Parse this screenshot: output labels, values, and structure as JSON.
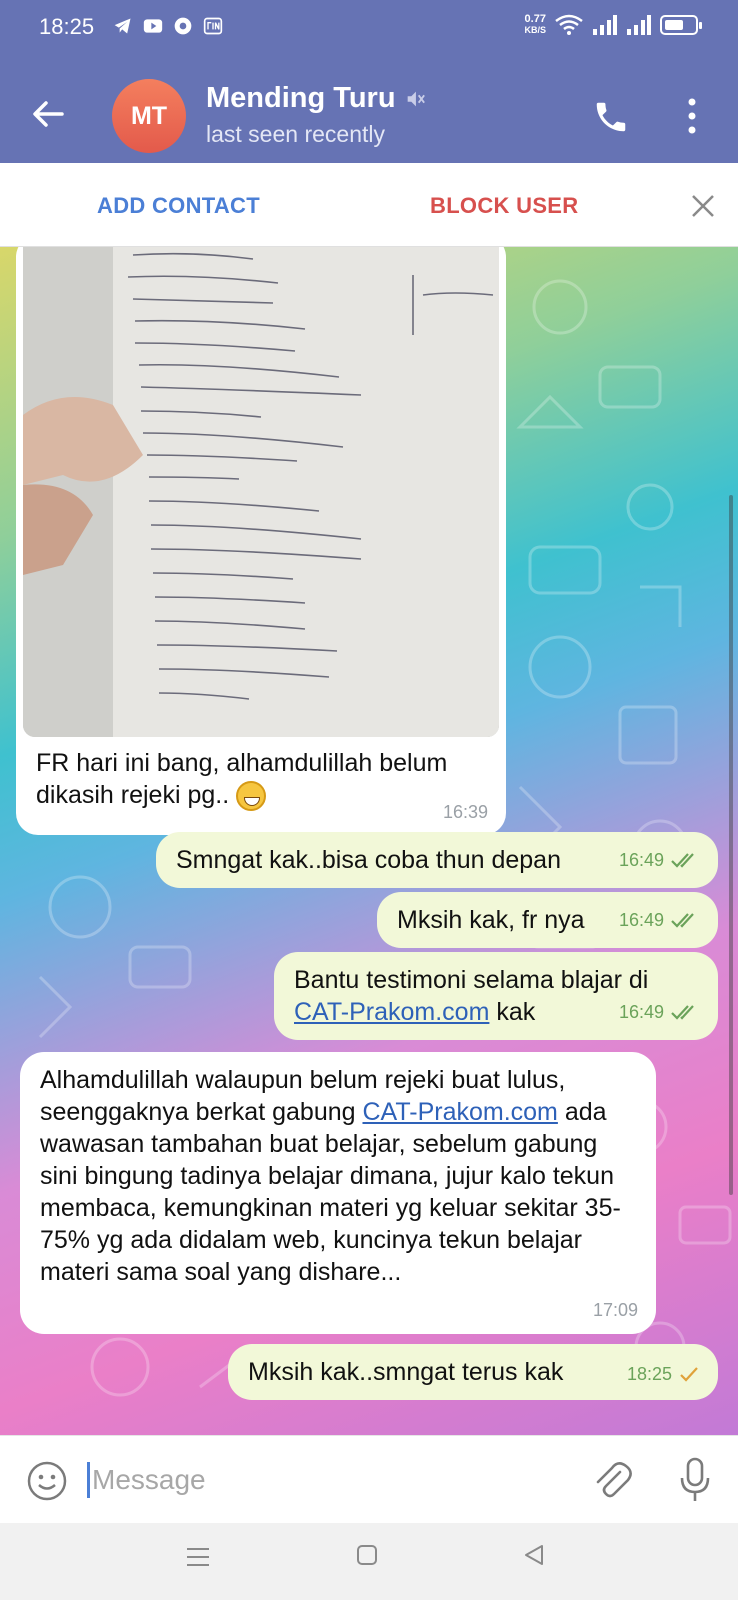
{
  "status_bar": {
    "time": "18:25",
    "left_icons": [
      "telegram-icon",
      "youtube-icon",
      "app-icon",
      "sim-label-icon"
    ],
    "net_speed_value": "0.77",
    "net_speed_unit": "KB/S",
    "right_icons": [
      "wifi-icon",
      "signal-icon",
      "signal-icon",
      "battery-icon"
    ]
  },
  "header": {
    "avatar_initials": "MT",
    "avatar_color": "#ee6e55",
    "name": "Mending Turu",
    "subtitle": "last seen recently",
    "bar_color": "#6673b4"
  },
  "action_bar": {
    "add_contact": "ADD CONTACT",
    "block_user": "BLOCK USER"
  },
  "messages": [
    {
      "direction": "in",
      "type": "photo",
      "caption": "FR hari ini bang, alhamdulillah belum dikasih rejeki pg..",
      "emoji": "grinning-face",
      "time": "16:39"
    },
    {
      "direction": "out",
      "text": "Smngat kak..bisa coba thun depan",
      "time": "16:49",
      "status": "read"
    },
    {
      "direction": "out",
      "text": "Mksih kak, fr nya",
      "time": "16:49",
      "status": "read"
    },
    {
      "direction": "out",
      "text_before": "Bantu testimoni selama blajar di",
      "link": "CAT-Prakom.com",
      "text_after": "kak",
      "time": "16:49",
      "status": "read"
    },
    {
      "direction": "in",
      "text_before": "Alhamdulillah walaupun belum rejeki buat lulus, seenggaknya berkat gabung",
      "link": "CAT-Prakom.com",
      "text_after": "ada wawasan tambahan buat belajar, sebelum gabung sini bingung tadinya belajar dimana, jujur kalo tekun membaca, kemungkinan materi yg keluar sekitar 35-75% yg ada didalam web, kuncinya tekun belajar materi sama soal yang dishare...",
      "time": "17:09"
    },
    {
      "direction": "out",
      "text": "Mksih kak..smngat terus kak",
      "time": "18:25",
      "status": "sent"
    }
  ],
  "input": {
    "placeholder": "Message"
  },
  "colors": {
    "link": "#2e61b8",
    "add_contact": "#4b7fd6",
    "block_user": "#d7504e",
    "outgoing_bubble": "#f2f8d8"
  }
}
